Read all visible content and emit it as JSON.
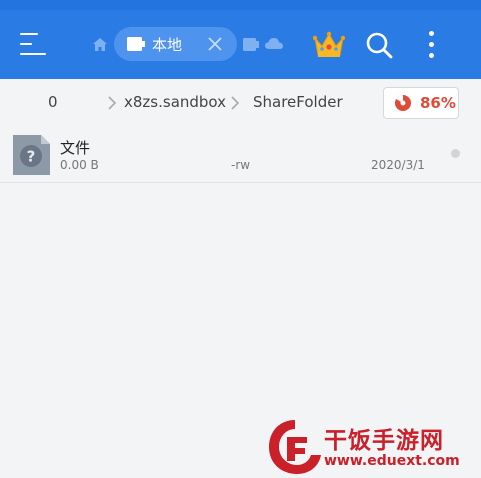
{
  "header": {
    "tabs": [
      {
        "label": "本地",
        "active": true
      }
    ]
  },
  "breadcrumb": {
    "items": [
      "0",
      "x8zs.sandbox",
      "ShareFolder"
    ]
  },
  "storage": {
    "percent_label": "86%",
    "used_fraction": 0.86
  },
  "files": [
    {
      "name": "文件",
      "size": "0.00 B",
      "permissions": "-rw",
      "date": "2020/3/1"
    }
  ],
  "watermark": {
    "title": "干饭手游网",
    "url": "www.eduext.com"
  },
  "colors": {
    "accent": "#2a7be4",
    "tab_active": "#4e93ee",
    "storage_red": "#e04a36",
    "watermark_red": "#c9202a"
  },
  "icons": [
    "menu-icon",
    "home-icon",
    "phone-icon",
    "close-icon",
    "device-icon",
    "cloud-icon",
    "crown-icon",
    "search-icon",
    "more-icon",
    "chevron-right-icon",
    "pie-chart-icon",
    "unknown-file-icon"
  ]
}
